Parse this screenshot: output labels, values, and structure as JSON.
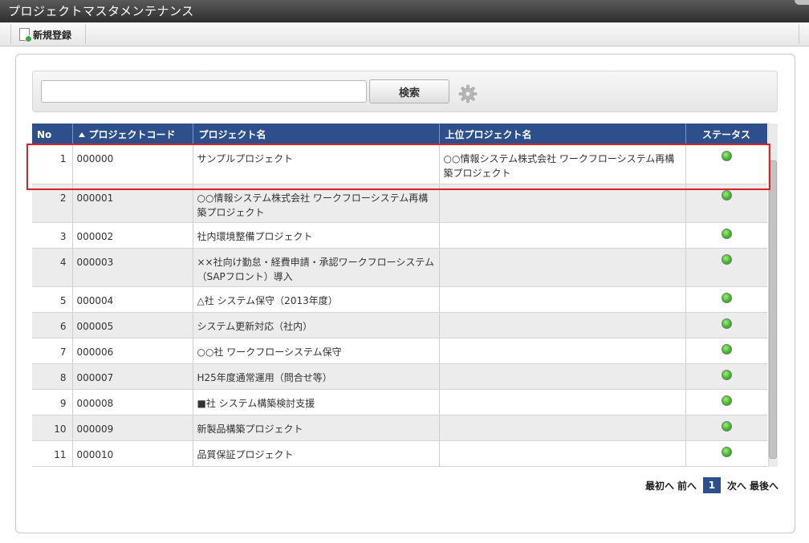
{
  "window": {
    "title": "プロジェクトマスタメンテナンス"
  },
  "toolbar": {
    "new_label": "新規登録",
    "new_icon": "new-document-icon"
  },
  "search": {
    "value": "",
    "placeholder": "",
    "button_label": "検索",
    "settings_icon": "gear-icon"
  },
  "table": {
    "columns": [
      "No",
      "プロジェクトコード",
      "プロジェクト名",
      "上位プロジェクト名",
      "ステータス"
    ],
    "sort": {
      "column": "プロジェクトコード",
      "direction": "asc"
    },
    "rows": [
      {
        "no": "1",
        "code": "000000",
        "name": "サンプルプロジェクト",
        "parent": "○○情報システム株式会社 ワークフローシステム再構築プロジェクト",
        "status": "active"
      },
      {
        "no": "2",
        "code": "000001",
        "name": "○○情報システム株式会社 ワークフローシステム再構築プロジェクト",
        "parent": "",
        "status": "active"
      },
      {
        "no": "3",
        "code": "000002",
        "name": "社内環境整備プロジェクト",
        "parent": "",
        "status": "active"
      },
      {
        "no": "4",
        "code": "000003",
        "name": "××社向け勤怠・経費申請・承認ワークフローシステム（SAPフロント）導入",
        "parent": "",
        "status": "active"
      },
      {
        "no": "5",
        "code": "000004",
        "name": "△社 システム保守（2013年度）",
        "parent": "",
        "status": "active"
      },
      {
        "no": "6",
        "code": "000005",
        "name": "システム更新対応（社内）",
        "parent": "",
        "status": "active"
      },
      {
        "no": "7",
        "code": "000006",
        "name": "○○社 ワークフローシステム保守",
        "parent": "",
        "status": "active"
      },
      {
        "no": "8",
        "code": "000007",
        "name": "H25年度通常運用（問合せ等）",
        "parent": "",
        "status": "active"
      },
      {
        "no": "9",
        "code": "000008",
        "name": "■社 システム構築検討支援",
        "parent": "",
        "status": "active"
      },
      {
        "no": "10",
        "code": "000009",
        "name": "新製品構築プロジェクト",
        "parent": "",
        "status": "active"
      },
      {
        "no": "11",
        "code": "000010",
        "name": "品質保証プロジェクト",
        "parent": "",
        "status": "active"
      }
    ],
    "highlighted_row": 1
  },
  "colors": {
    "header_bg": "#2d4f8c",
    "status_ok": "#3fbb2a",
    "highlight": "#d9222a"
  },
  "pager": {
    "first": "最初へ",
    "prev": "前へ",
    "current": "1",
    "next": "次へ",
    "last": "最後へ"
  }
}
